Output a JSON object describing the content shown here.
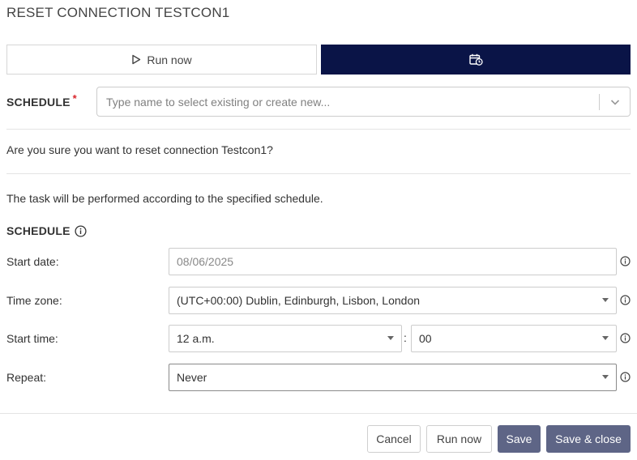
{
  "dialog": {
    "title": "RESET CONNECTION TESTCON1"
  },
  "tabs": {
    "run_now_label": "Run now"
  },
  "schedule_select": {
    "label": "SCHEDULE",
    "required_mark": "*",
    "placeholder": "Type name to select existing or create new..."
  },
  "confirm_text": "Are you sure you want to reset connection Testcon1?",
  "info_text": "The task will be performed according to the specified schedule.",
  "schedule_section": {
    "heading": "SCHEDULE",
    "start_date": {
      "label": "Start date:",
      "value": "08/06/2025"
    },
    "time_zone": {
      "label": "Time zone:",
      "value": "(UTC+00:00) Dublin, Edinburgh, Lisbon, London"
    },
    "start_time": {
      "label": "Start time:",
      "hour": "12 a.m.",
      "separator": ":",
      "minute": "00"
    },
    "repeat": {
      "label": "Repeat:",
      "value": "Never"
    }
  },
  "footer": {
    "cancel": "Cancel",
    "run_now": "Run now",
    "save": "Save",
    "save_close": "Save & close"
  },
  "colors": {
    "primary_dark": "#0a1447",
    "button_solid": "#5e6586",
    "required": "#d9262c"
  }
}
